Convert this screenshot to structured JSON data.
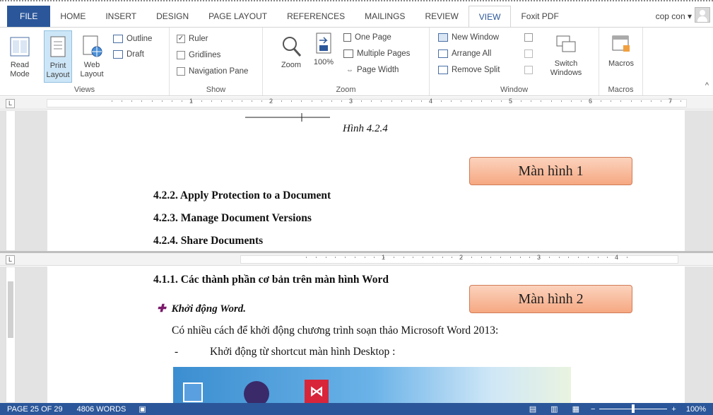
{
  "tabs": {
    "file": "FILE",
    "items": [
      "HOME",
      "INSERT",
      "DESIGN",
      "PAGE LAYOUT",
      "REFERENCES",
      "MAILINGS",
      "REVIEW",
      "VIEW",
      "Foxit PDF"
    ],
    "user": "cop con"
  },
  "ribbon": {
    "views": {
      "read_mode": "Read Mode",
      "print_layout": "Print Layout",
      "web_layout": "Web Layout",
      "outline": "Outline",
      "draft": "Draft",
      "label": "Views"
    },
    "show": {
      "ruler": "Ruler",
      "gridlines": "Gridlines",
      "navigation": "Navigation Pane",
      "label": "Show"
    },
    "zoom": {
      "zoom": "Zoom",
      "percent": "100%",
      "one_page": "One Page",
      "multiple_pages": "Multiple Pages",
      "page_width": "Page Width",
      "label": "Zoom"
    },
    "window": {
      "new_window": "New Window",
      "arrange_all": "Arrange All",
      "remove_split": "Remove Split",
      "switch_windows": "Switch Windows",
      "label": "Window"
    },
    "macros": {
      "macros": "Macros",
      "label": "Macros"
    }
  },
  "ruler_numbers": [
    "1",
    "2",
    "3",
    "4",
    "5",
    "6",
    "7"
  ],
  "ruler2_numbers": [
    "1",
    "2",
    "3",
    "4"
  ],
  "pane1": {
    "caption": "Hình 4.2.4",
    "h1": "4.2.2.",
    "h1_text": "Apply Protection to a Document",
    "h2": "4.2.3.",
    "h2_text": "Manage Document Versions",
    "h3": "4.2.4.",
    "h3_text": "Share Documents",
    "callout": "Màn hình 1"
  },
  "pane2": {
    "h1": "4.1.1.",
    "h1_text": "Các thành phần cơ bản trên màn hình Word",
    "bullet": "Khởi động Word.",
    "para": "Có nhiều cách để khởi động chương trình soạn thảo Microsoft Word 2013:",
    "dash": "-",
    "list": "Khởi động từ shortcut màn hình Desktop :",
    "callout": "Màn hình 2"
  },
  "status": {
    "page": "PAGE 25 OF 29",
    "words": "4806 WORDS",
    "zoom": "100%"
  },
  "colors": {
    "accent": "#2b579a",
    "callout": "#f6a882"
  }
}
